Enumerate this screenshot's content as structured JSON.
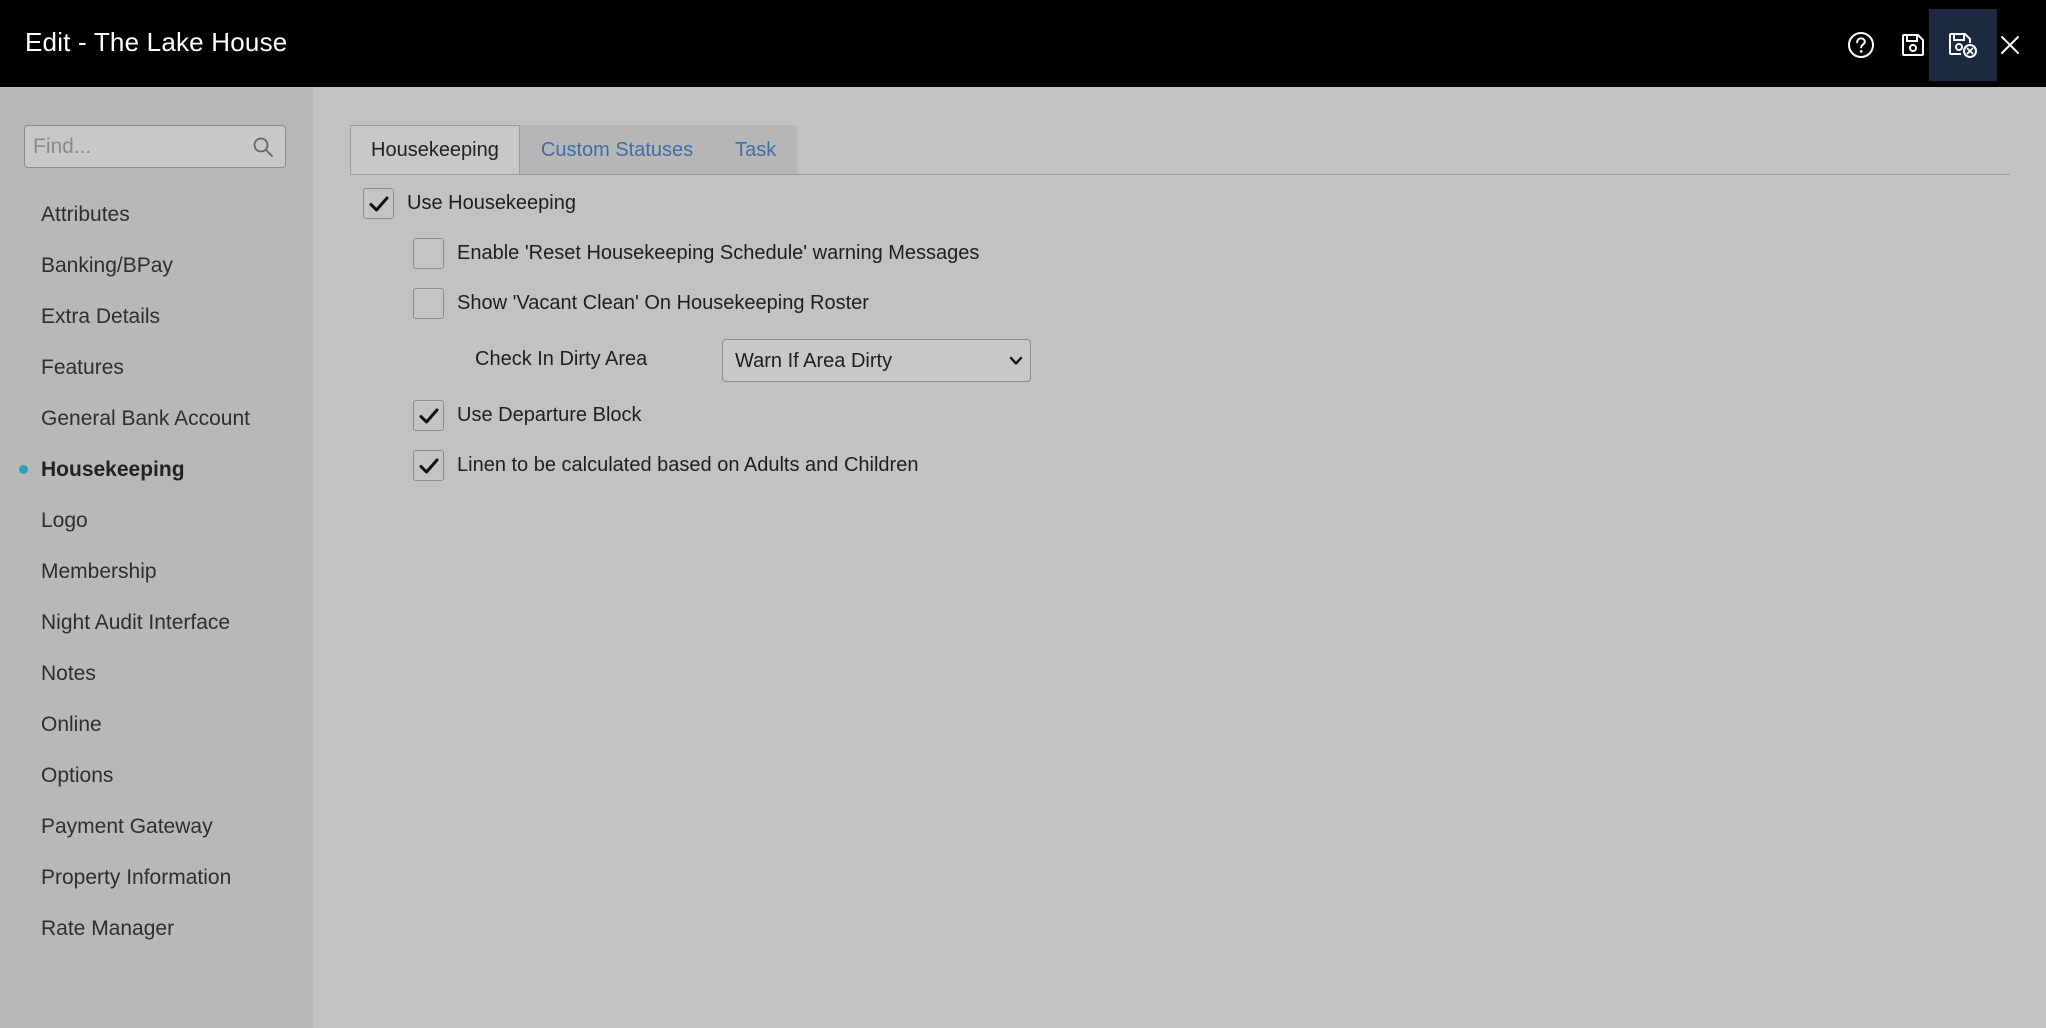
{
  "window": {
    "title": "Edit - The Lake House"
  },
  "header": {
    "buttons": [
      {
        "name": "help",
        "icon": "help-icon"
      },
      {
        "name": "save",
        "icon": "save-icon"
      },
      {
        "name": "save-and-close",
        "icon": "save-close-icon"
      },
      {
        "name": "close",
        "icon": "close-icon"
      }
    ]
  },
  "sidebar": {
    "search": {
      "placeholder": "Find...",
      "value": ""
    },
    "items": [
      {
        "label": "Attributes",
        "active": false
      },
      {
        "label": "Banking/BPay",
        "active": false
      },
      {
        "label": "Extra Details",
        "active": false
      },
      {
        "label": "Features",
        "active": false
      },
      {
        "label": "General Bank Account",
        "active": false
      },
      {
        "label": "Housekeeping",
        "active": true
      },
      {
        "label": "Logo",
        "active": false
      },
      {
        "label": "Membership",
        "active": false
      },
      {
        "label": "Night Audit Interface",
        "active": false
      },
      {
        "label": "Notes",
        "active": false
      },
      {
        "label": "Online",
        "active": false
      },
      {
        "label": "Options",
        "active": false
      },
      {
        "label": "Payment Gateway",
        "active": false
      },
      {
        "label": "Property Information",
        "active": false
      },
      {
        "label": "Rate Manager",
        "active": false
      }
    ]
  },
  "main": {
    "tabs": [
      {
        "label": "Housekeeping",
        "active": true
      },
      {
        "label": "Custom Statuses",
        "active": false
      },
      {
        "label": "Task",
        "active": false
      }
    ],
    "options": {
      "use_housekeeping": {
        "label": "Use Housekeeping",
        "checked": true
      },
      "reset_warning": {
        "label": "Enable 'Reset Housekeeping Schedule' warning Messages",
        "checked": false
      },
      "vacant_clean": {
        "label": "Show 'Vacant Clean' On Housekeeping Roster",
        "checked": false
      },
      "departure_block": {
        "label": "Use Departure Block",
        "checked": true
      },
      "linen_calc": {
        "label": "Linen to be calculated based on Adults and Children",
        "checked": true
      }
    },
    "check_in_dirty_area": {
      "label": "Check In Dirty Area",
      "selected": "Warn If Area Dirty"
    }
  },
  "colors": {
    "header_bg": "#000000",
    "active_header_button": "#1b2a3f",
    "sidebar_bg": "#b8b8b8",
    "main_bg": "#c2c2c2",
    "nav_dot": "#2aa0b8",
    "tab_link": "#3e6da8"
  }
}
